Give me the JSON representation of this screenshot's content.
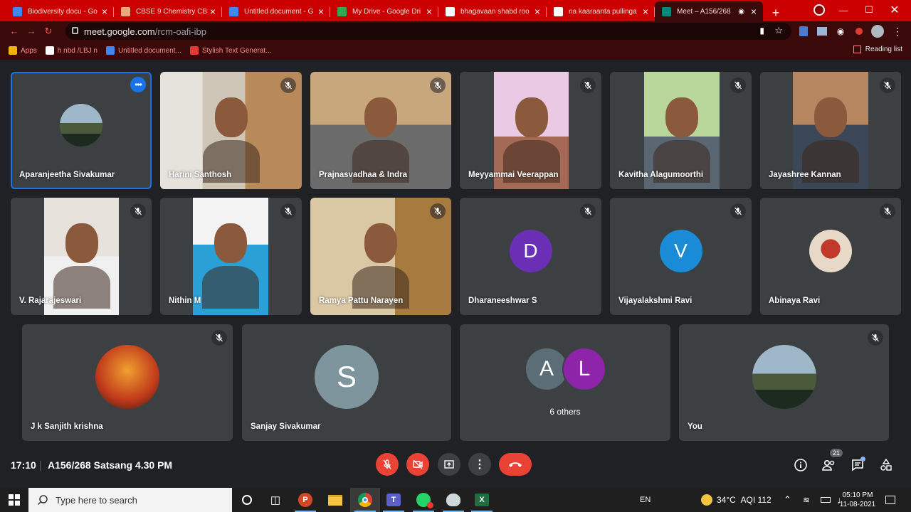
{
  "browser": {
    "tabs": [
      {
        "title": "Biodiversity docu - Go",
        "icon": "docs-icon",
        "color": "#4285f4"
      },
      {
        "title": "CBSE 9 Chemistry CBS",
        "icon": "site-icon",
        "color": "#e8a87c"
      },
      {
        "title": "Untitled document - G",
        "icon": "docs-icon",
        "color": "#4285f4"
      },
      {
        "title": "My Drive - Google Dri",
        "icon": "drive-icon",
        "color": "#34a853"
      },
      {
        "title": "bhagavaan shabd roo",
        "icon": "google-icon",
        "color": "#ffffff"
      },
      {
        "title": "na kaaraanta pullinga",
        "icon": "google-icon",
        "color": "#ffffff"
      },
      {
        "title": "Meet – A156/268",
        "icon": "meet-icon",
        "color": "#00897b"
      }
    ],
    "url_host": "meet.google.com",
    "url_path": "/rcm-oafi-ibp",
    "bookmarks": [
      {
        "label": "Apps",
        "icon": "apps-grid-icon"
      },
      {
        "label": "h nbd /LBJ n",
        "icon": "site-icon"
      },
      {
        "label": "Untitled document...",
        "icon": "docs-icon"
      },
      {
        "label": "Stylish Text Generat...",
        "icon": "site-icon"
      }
    ],
    "reading_list": "Reading list"
  },
  "meet": {
    "participants": [
      {
        "name": "Aparanjeetha Sivakumar",
        "type": "avatar-photo",
        "pinned_menu": true
      },
      {
        "name": "Harini Santhosh",
        "type": "video",
        "muted": true
      },
      {
        "name": "Prajnasvadhaa & Indra",
        "type": "video",
        "muted": true
      },
      {
        "name": "Meyyammai Veerappan",
        "type": "video",
        "muted": true
      },
      {
        "name": "Kavitha Alagumoorthi",
        "type": "video",
        "muted": true
      },
      {
        "name": "Jayashree Kannan",
        "type": "video",
        "muted": true
      },
      {
        "name": "V. Rajarajeswari",
        "type": "video",
        "muted": true
      },
      {
        "name": "Nithin M",
        "type": "video",
        "muted": true
      },
      {
        "name": "Ramya Pattu Narayen",
        "type": "video",
        "muted": true
      },
      {
        "name": "Dharaneeshwar S",
        "type": "avatar-letter",
        "letter": "D",
        "color": "#6a2fb5",
        "muted": true
      },
      {
        "name": "Vijayalakshmi Ravi",
        "type": "avatar-letter",
        "letter": "V",
        "color": "#1a8bd6",
        "muted": true
      },
      {
        "name": "Abinaya Ravi",
        "type": "avatar-photo",
        "muted": true
      },
      {
        "name": "J k Sanjith krishna",
        "type": "avatar-photo",
        "muted": true
      },
      {
        "name": "Sanjay Sivakumar",
        "type": "avatar-letter",
        "letter": "S",
        "color": "#7e959e",
        "muted": false
      },
      {
        "name": "You",
        "type": "avatar-photo",
        "muted": true
      }
    ],
    "others": {
      "label": "6 others",
      "letters": [
        "A",
        "L"
      ],
      "colors": [
        "#5b6d76",
        "#8e24aa"
      ]
    },
    "clock": "17:10",
    "meeting_title": "A156/268 Satsang 4.30 PM",
    "people_count": "21"
  },
  "taskbar": {
    "search_placeholder": "Type here to search",
    "lang": "EN",
    "weather": "34°C",
    "aqi": "AQI 112",
    "time": "05:10 PM",
    "date": "11-08-2021"
  }
}
